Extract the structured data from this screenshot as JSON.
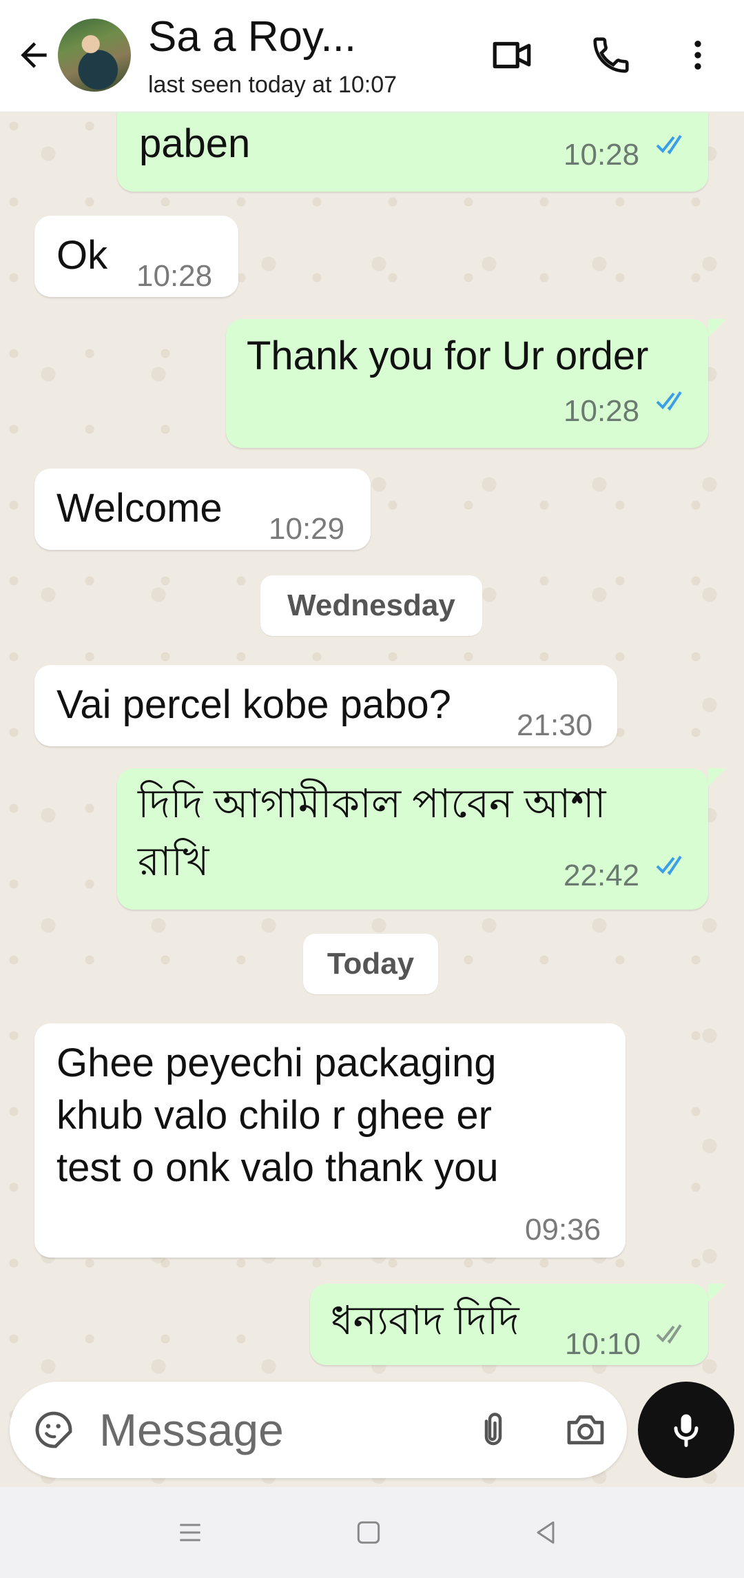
{
  "header": {
    "contact_name": "Sa  a Roy...",
    "status": "last seen today at 10:07",
    "icons": [
      "back-arrow-icon",
      "video-camera-icon",
      "phone-icon",
      "more-vert-icon"
    ]
  },
  "messages": [
    {
      "dir": "out",
      "text": "paben",
      "time": "10:28",
      "ticks": "read"
    },
    {
      "dir": "in",
      "text": "Ok",
      "time": "10:28"
    },
    {
      "dir": "out",
      "text": "Thank you for Ur order",
      "time": "10:28",
      "ticks": "read"
    },
    {
      "dir": "in",
      "text": "Welcome",
      "time": "10:29"
    },
    {
      "date": "Wednesday"
    },
    {
      "dir": "in",
      "text": "Vai percel kobe pabo?",
      "time": "21:30"
    },
    {
      "dir": "out",
      "text_lines": [
        "দিদি আগামীকাল পাবেন আশা",
        "রাখি"
      ],
      "time": "22:42",
      "ticks": "read"
    },
    {
      "date": "Today"
    },
    {
      "dir": "in",
      "text_lines": [
        "Ghee peyechi packaging",
        "khub valo chilo r ghee er",
        "test o onk valo thank you"
      ],
      "time": "09:36"
    },
    {
      "dir": "out",
      "text": "ধন্যবাদ দিদি",
      "time": "10:10",
      "ticks": "delivered"
    }
  ],
  "input": {
    "placeholder": "Message",
    "icons": [
      "sticker-emoji-icon",
      "paperclip-icon",
      "camera-icon",
      "microphone-icon"
    ]
  },
  "navbar": {
    "icons": [
      "recent-apps-icon",
      "home-icon",
      "back-triangle-icon"
    ]
  },
  "colors": {
    "outgoing_bubble": "#d9fdd3",
    "incoming_bubble": "#ffffff",
    "chat_background": "#efeae2",
    "read_ticks": "#3b9fe8",
    "delivered_ticks": "#8a9a8e",
    "mic_button": "#111111"
  }
}
